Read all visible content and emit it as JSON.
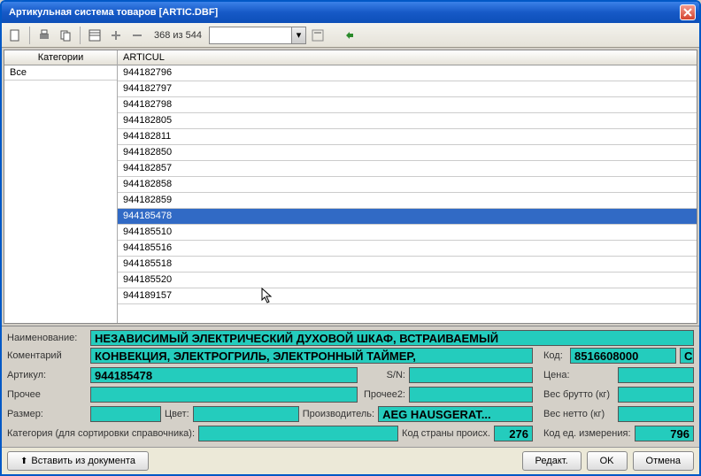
{
  "window": {
    "title": "Артикульная система товаров   [ARTIC.DBF]"
  },
  "toolbar": {
    "paginfo": "368 из 544"
  },
  "categories": {
    "header": "Категории",
    "items": [
      "Все"
    ]
  },
  "grid": {
    "header": "ARTICUL",
    "rows": [
      "944182796",
      "944182797",
      "944182798",
      "944182805",
      "944182811",
      "944182850",
      "944182857",
      "944182858",
      "944182859",
      "944185478",
      "944185510",
      "944185516",
      "944185518",
      "944185520",
      "944189157"
    ],
    "selected": 9
  },
  "details": {
    "name_label": "Наименование:",
    "name": "НЕЗАВИСИМЫЙ ЭЛЕКТРИЧЕСКИЙ ДУХОВОЙ ШКАФ, ВСТРАИВАЕМЫЙ",
    "comment_label": "Коментарий",
    "comment": "КОНВЕКЦИЯ, ЭЛЕКТРОГРИЛЬ, ЭЛЕКТРОННЫЙ ТАЙМЕР,",
    "articul_label": "Артикул:",
    "articul": "944185478",
    "sn_label": "S/N:",
    "sn": "",
    "other_label": "Прочее",
    "other": "",
    "other2_label": "Прочее2:",
    "other2": "",
    "size_label": "Размер:",
    "size": "",
    "color_label": "Цвет:",
    "color": "",
    "manuf_label": "Производитель:",
    "manuf": "AEG HAUSGERAT...",
    "catsort_label": "Категория (для сортировки справочника):",
    "catsort": "",
    "country_label": "Код страны происх.",
    "country": "276",
    "code_label": "Код:",
    "code": "8516608000",
    "code_suffix": "С",
    "price_label": "Цена:",
    "price": "",
    "wgross_label": "Вес брутто (кг)",
    "wgross": "",
    "wnet_label": "Вес нетто (кг)",
    "wnet": "",
    "unit_label": "Код ед. измерения:",
    "unit": "796"
  },
  "footer": {
    "insert": "Вставить из документа",
    "edit": "Редакт.",
    "ok": "OK",
    "cancel": "Отмена"
  }
}
